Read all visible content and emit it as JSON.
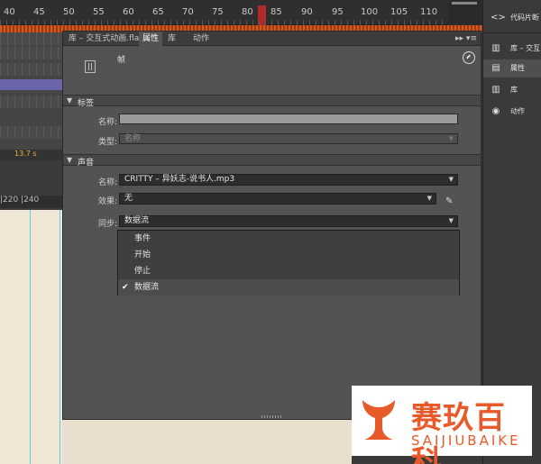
{
  "timeline": {
    "ruler_numbers": [
      "40",
      "45",
      "50",
      "55",
      "60",
      "65",
      "70",
      "75",
      "80",
      "85",
      "90",
      "95",
      "100",
      "105",
      "110"
    ],
    "current_time": "13.7 s",
    "stage_ruler": "|220  |240"
  },
  "panel": {
    "tabs": [
      "库 – 交互式动画.fla",
      "属性",
      "库",
      "动作"
    ],
    "active_tab": "属性",
    "frame_label": "帧",
    "sections": {
      "label": "标签",
      "sound": "声音"
    },
    "label_section": {
      "name_label": "名称:",
      "name_value": "",
      "type_label": "类型:",
      "type_value": "名称"
    },
    "sound_section": {
      "name_label": "名称:",
      "name_value": "CRITTY – 异妖志-说书人.mp3",
      "effect_label": "效果:",
      "effect_value": "无",
      "sync_label": "同步:",
      "sync_value": "数据流",
      "sync_options": [
        "事件",
        "开始",
        "停止",
        "数据流"
      ],
      "sync_selected_index": 3
    }
  },
  "dock": {
    "items": [
      {
        "label": "代码片断",
        "icon": "code-snippets-icon"
      },
      {
        "label": "库 – 交互",
        "icon": "library-doc-icon"
      },
      {
        "label": "属性",
        "icon": "properties-icon"
      },
      {
        "label": "库",
        "icon": "library-icon"
      },
      {
        "label": "动作",
        "icon": "actions-icon"
      }
    ],
    "active_item": "属性"
  },
  "watermark": {
    "chinese": "赛玖百科",
    "english": "SAIJIUBAIKE",
    "color": "#e85a2a"
  }
}
